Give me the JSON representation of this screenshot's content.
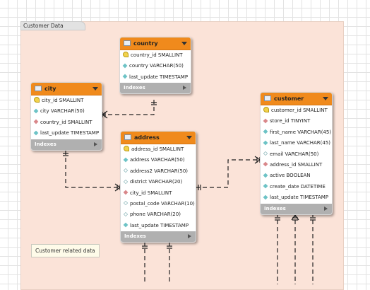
{
  "region": {
    "label": "Customer Data"
  },
  "note": {
    "label": "Customer related data"
  },
  "tables": {
    "country": {
      "name": "country",
      "columns": [
        {
          "text": "country_id SMALLINT",
          "key": "pk"
        },
        {
          "text": "country VARCHAR(50)",
          "key": "nn"
        },
        {
          "text": "last_update TIMESTAMP",
          "key": "nn"
        }
      ],
      "footer": "Indexes"
    },
    "city": {
      "name": "city",
      "columns": [
        {
          "text": "city_id SMALLINT",
          "key": "pk"
        },
        {
          "text": "city VARCHAR(50)",
          "key": "nn"
        },
        {
          "text": "country_id SMALLINT",
          "key": "fk"
        },
        {
          "text": "last_update TIMESTAMP",
          "key": "nn"
        }
      ],
      "footer": "Indexes"
    },
    "address": {
      "name": "address",
      "columns": [
        {
          "text": "address_id SMALLINT",
          "key": "pk"
        },
        {
          "text": "address VARCHAR(50)",
          "key": "nn"
        },
        {
          "text": "address2 VARCHAR(50)",
          "key": "op"
        },
        {
          "text": "district VARCHAR(20)",
          "key": "op"
        },
        {
          "text": "city_id SMALLINT",
          "key": "fk"
        },
        {
          "text": "postal_code VARCHAR(10)",
          "key": "op"
        },
        {
          "text": "phone VARCHAR(20)",
          "key": "op"
        },
        {
          "text": "last_update TIMESTAMP",
          "key": "nn"
        }
      ],
      "footer": "Indexes"
    },
    "customer": {
      "name": "customer",
      "columns": [
        {
          "text": "customer_id SMALLINT",
          "key": "pk"
        },
        {
          "text": "store_id TINYINT",
          "key": "fk"
        },
        {
          "text": "first_name VARCHAR(45)",
          "key": "nn"
        },
        {
          "text": "last_name VARCHAR(45)",
          "key": "nn"
        },
        {
          "text": "email VARCHAR(50)",
          "key": "op"
        },
        {
          "text": "address_id SMALLINT",
          "key": "fk"
        },
        {
          "text": "active BOOLEAN",
          "key": "nn"
        },
        {
          "text": "create_date DATETIME",
          "key": "nn"
        },
        {
          "text": "last_update TIMESTAMP",
          "key": "nn"
        }
      ],
      "footer": "Indexes"
    }
  },
  "colors": {
    "header": "#f08a1c",
    "footer": "#b0b0b0",
    "region": "#fbe3d8"
  }
}
